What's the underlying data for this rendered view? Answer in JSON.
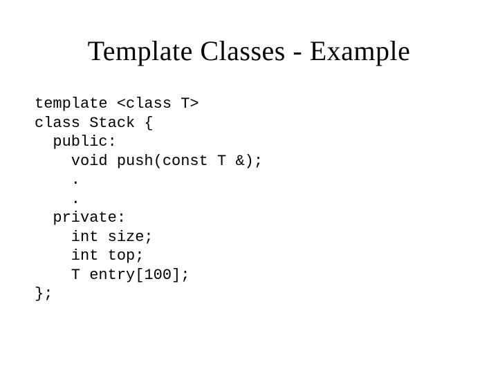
{
  "slide": {
    "title": "Template Classes - Example",
    "code": {
      "l1": "template <class T>",
      "l2": "class Stack {",
      "l3": "  public:",
      "l4": "    void push(const T &);",
      "l5": "    .",
      "l6": "    .",
      "l7": "  private:",
      "l8": "    int size;",
      "l9": "    int top;",
      "l10": "    T entry[100];",
      "l11": "};"
    }
  }
}
